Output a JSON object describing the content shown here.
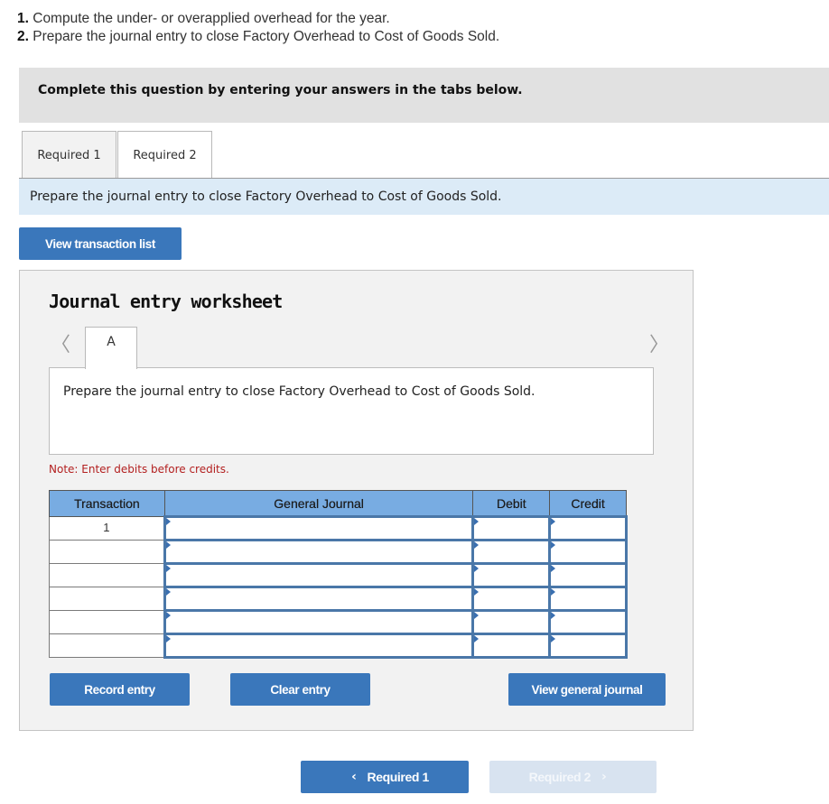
{
  "questions": [
    {
      "num": "1.",
      "text": " Compute the under- or overapplied overhead for the year."
    },
    {
      "num": "2.",
      "text": " Prepare the journal entry to close Factory Overhead to Cost of Goods Sold."
    }
  ],
  "instructions": "Complete this question by entering your answers in the tabs below.",
  "tabs": [
    {
      "label": "Required 1",
      "active": false
    },
    {
      "label": "Required 2",
      "active": true
    }
  ],
  "prompt": "Prepare the journal entry to close Factory Overhead to Cost of Goods Sold.",
  "view_transaction_list_label": "View transaction list",
  "worksheet": {
    "title": "Journal entry worksheet",
    "prev_icon": "chevron-left-icon",
    "next_icon": "chevron-right-icon",
    "tab_label": "A",
    "description": "Prepare the journal entry to close Factory Overhead to Cost of Goods Sold.",
    "note": "Note: Enter debits before credits.",
    "table": {
      "headers": [
        "Transaction",
        "General Journal",
        "Debit",
        "Credit"
      ],
      "rows": [
        {
          "transaction": "1",
          "general_journal": "",
          "debit": "",
          "credit": ""
        },
        {
          "transaction": "",
          "general_journal": "",
          "debit": "",
          "credit": ""
        },
        {
          "transaction": "",
          "general_journal": "",
          "debit": "",
          "credit": ""
        },
        {
          "transaction": "",
          "general_journal": "",
          "debit": "",
          "credit": ""
        },
        {
          "transaction": "",
          "general_journal": "",
          "debit": "",
          "credit": ""
        },
        {
          "transaction": "",
          "general_journal": "",
          "debit": "",
          "credit": ""
        }
      ]
    },
    "buttons": {
      "record": "Record entry",
      "clear": "Clear entry",
      "view_general": "View general journal"
    }
  },
  "nav": {
    "prev_label": "Required 1",
    "next_label": "Required 2",
    "next_disabled": true
  },
  "colors": {
    "accent": "#3a77bb",
    "header_blue": "#78ace2",
    "prompt_bg": "#dcebf7",
    "note_red": "#b32020",
    "disabled_btn": "#d8e3f0"
  }
}
